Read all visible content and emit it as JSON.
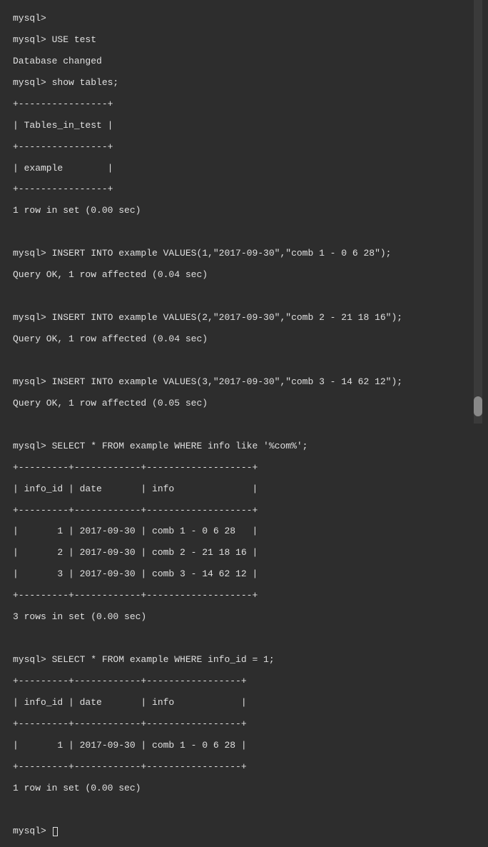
{
  "lines": {
    "p0": "mysql>",
    "p1": "mysql> USE test",
    "p2": "Database changed",
    "p3": "mysql> show tables;",
    "p4": "+----------------+",
    "p5": "| Tables_in_test |",
    "p6": "+----------------+",
    "p7": "| example        |",
    "p8": "+----------------+",
    "p9": "1 row in set (0.00 sec)",
    "blank1": " ",
    "p10": "mysql> INSERT INTO example VALUES(1,\"2017-09-30\",\"comb 1 - 0 6 28\");",
    "p11": "Query OK, 1 row affected (0.04 sec)",
    "blank2": " ",
    "p12": "mysql> INSERT INTO example VALUES(2,\"2017-09-30\",\"comb 2 - 21 18 16\");",
    "p13": "Query OK, 1 row affected (0.04 sec)",
    "blank3": " ",
    "p14": "mysql> INSERT INTO example VALUES(3,\"2017-09-30\",\"comb 3 - 14 62 12\");",
    "p15": "Query OK, 1 row affected (0.05 sec)",
    "blank4": " ",
    "p16": "mysql> SELECT * FROM example WHERE info like '%com%';",
    "p17": "+---------+------------+-------------------+",
    "p18": "| info_id | date       | info              |",
    "p19": "+---------+------------+-------------------+",
    "p20": "|       1 | 2017-09-30 | comb 1 - 0 6 28   |",
    "p21": "|       2 | 2017-09-30 | comb 2 - 21 18 16 |",
    "p22": "|       3 | 2017-09-30 | comb 3 - 14 62 12 |",
    "p23": "+---------+------------+-------------------+",
    "p24": "3 rows in set (0.00 sec)",
    "blank5": " ",
    "p25": "mysql> SELECT * FROM example WHERE info_id = 1;",
    "p26": "+---------+------------+-----------------+",
    "p27": "| info_id | date       | info            |",
    "p28": "+---------+------------+-----------------+",
    "p29": "|       1 | 2017-09-30 | comb 1 - 0 6 28 |",
    "p30": "+---------+------------+-----------------+",
    "p31": "1 row in set (0.00 sec)",
    "blank6": " ",
    "p32": "mysql> "
  }
}
